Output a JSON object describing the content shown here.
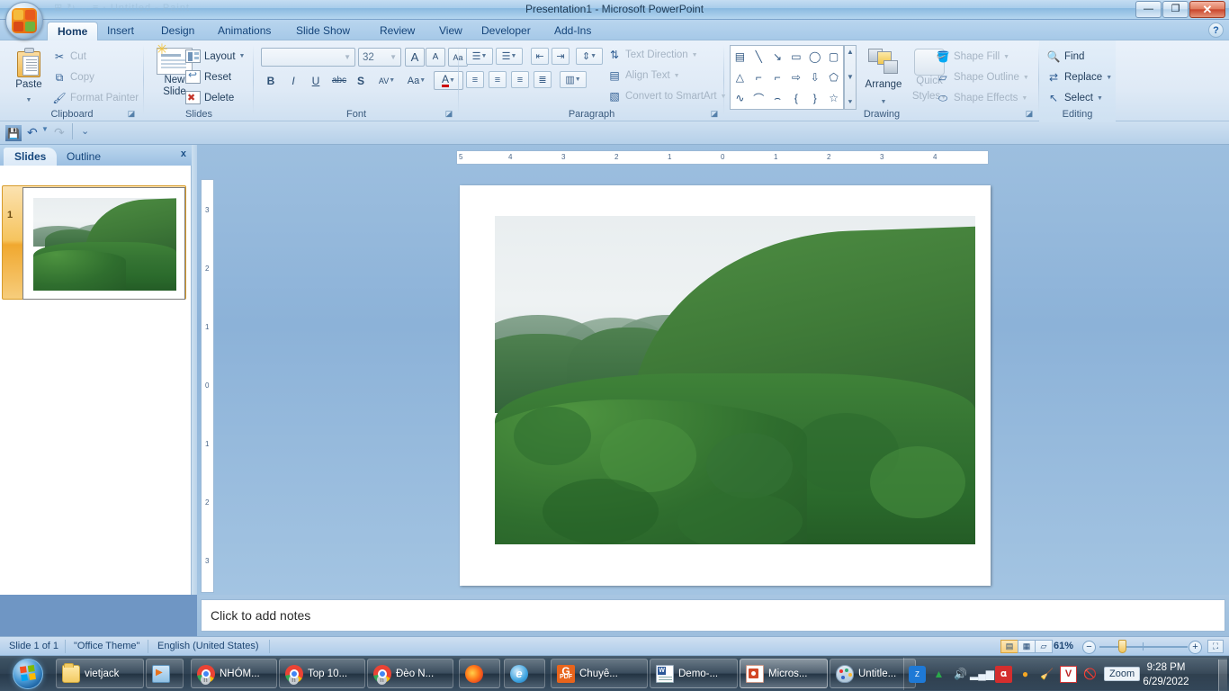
{
  "window": {
    "title": "Presentation1 - Microsoft PowerPoint",
    "ghost_title": "⊞ ↻ ⌄ ≡ ⋅ Untitled - Paint",
    "minimize": "—",
    "restore": "❐",
    "close": "✕",
    "help": "?"
  },
  "ribbon": {
    "tabs": [
      {
        "label": "Home",
        "active": true
      },
      {
        "label": "Insert",
        "active": false
      },
      {
        "label": "Design",
        "active": false
      },
      {
        "label": "Animations",
        "active": false
      },
      {
        "label": "Slide Show",
        "active": false
      },
      {
        "label": "Review",
        "active": false
      },
      {
        "label": "View",
        "active": false
      },
      {
        "label": "Developer",
        "active": false
      },
      {
        "label": "Add-Ins",
        "active": false
      }
    ],
    "clipboard": {
      "title": "Clipboard",
      "paste": "Paste",
      "cut": "Cut",
      "copy": "Copy",
      "format_painter": "Format Painter"
    },
    "slides": {
      "title": "Slides",
      "new_slide": "New",
      "new_slide2": "Slide",
      "layout": "Layout",
      "reset": "Reset",
      "delete": "Delete"
    },
    "font": {
      "title": "Font",
      "font_name": "",
      "font_name_placeholder": "",
      "font_size": "32",
      "grow": "A",
      "shrink": "A",
      "clear_formatting": "Aa",
      "bold": "B",
      "italic": "I",
      "underline": "U",
      "strikethrough": "abc",
      "shadow": "S",
      "spacing": "AV",
      "change_case": "Aa",
      "font_color": "A"
    },
    "paragraph": {
      "title": "Paragraph",
      "text_direction": "Text Direction",
      "align_text": "Align Text",
      "convert_smartart": "Convert to SmartArt"
    },
    "drawing": {
      "title": "Drawing",
      "arrange": "Arrange",
      "quick_styles": "Quick",
      "quick_styles2": "Styles",
      "shape_fill": "Shape Fill",
      "shape_outline": "Shape Outline",
      "shape_effects": "Shape Effects",
      "shapes": [
        "▤",
        "╲",
        "↘",
        "▭",
        "◯",
        "▢",
        "△",
        "⌐",
        "⌐",
        "⇨",
        "⇩",
        "⬠",
        "∿",
        "⌒",
        "⌢",
        "{",
        "}",
        "☆"
      ]
    },
    "editing": {
      "title": "Editing",
      "find": "Find",
      "replace": "Replace",
      "select": "Select"
    }
  },
  "quick_access": {
    "save": "💾",
    "undo": "↶",
    "redo": "↷",
    "customize": "⌄"
  },
  "left_pane": {
    "tab_slides": "Slides",
    "tab_outline": "Outline",
    "close": "x",
    "slide_number": "1"
  },
  "rulers": {
    "horizontal": [
      "5",
      "4",
      "3",
      "2",
      "1",
      "0",
      "1",
      "2",
      "3",
      "4"
    ],
    "vertical": [
      "3",
      "2",
      "1",
      "0",
      "1",
      "2",
      "3"
    ]
  },
  "notes": {
    "placeholder": "Click to add notes"
  },
  "status_bar": {
    "slide_indicator": "Slide 1 of 1",
    "theme": "\"Office Theme\"",
    "language": "English (United States)",
    "zoom_level": "61%",
    "zoom_out": "−",
    "zoom_in": "+",
    "view_normal": "▤",
    "view_sorter": "▦",
    "view_slideshow": "▱",
    "fit_window": "⛶"
  },
  "taskbar": {
    "start": "start-orb",
    "buttons": [
      {
        "label": "vietjack",
        "icon": "folder",
        "active": false
      },
      {
        "label": "",
        "icon": "media-player",
        "active": false
      },
      {
        "label": "NHÓM...",
        "icon": "chrome",
        "active": false
      },
      {
        "label": "Top 10...",
        "icon": "chrome",
        "active": false
      },
      {
        "label": "Đèo N...",
        "icon": "chrome",
        "active": false
      },
      {
        "label": "",
        "icon": "firefox",
        "active": false
      },
      {
        "label": "",
        "icon": "internet-explorer",
        "active": false
      },
      {
        "label": "Chuyê...",
        "icon": "pdf",
        "active": false
      },
      {
        "label": "Demo-...",
        "icon": "word",
        "active": false
      },
      {
        "label": "Micros...",
        "icon": "powerpoint",
        "active": true
      },
      {
        "label": "Untitle...",
        "icon": "paint",
        "active": false
      }
    ],
    "tray": {
      "items": [
        "zalo-icon",
        "google-drive-icon",
        "volume-icon",
        "network-icon",
        "avira-icon",
        "unikey-icon",
        "cleaner-icon",
        "v-icon",
        "blocked-icon"
      ],
      "zoom_label": "Zoom",
      "time": "9:28 PM",
      "date": "6/29/2022"
    }
  }
}
